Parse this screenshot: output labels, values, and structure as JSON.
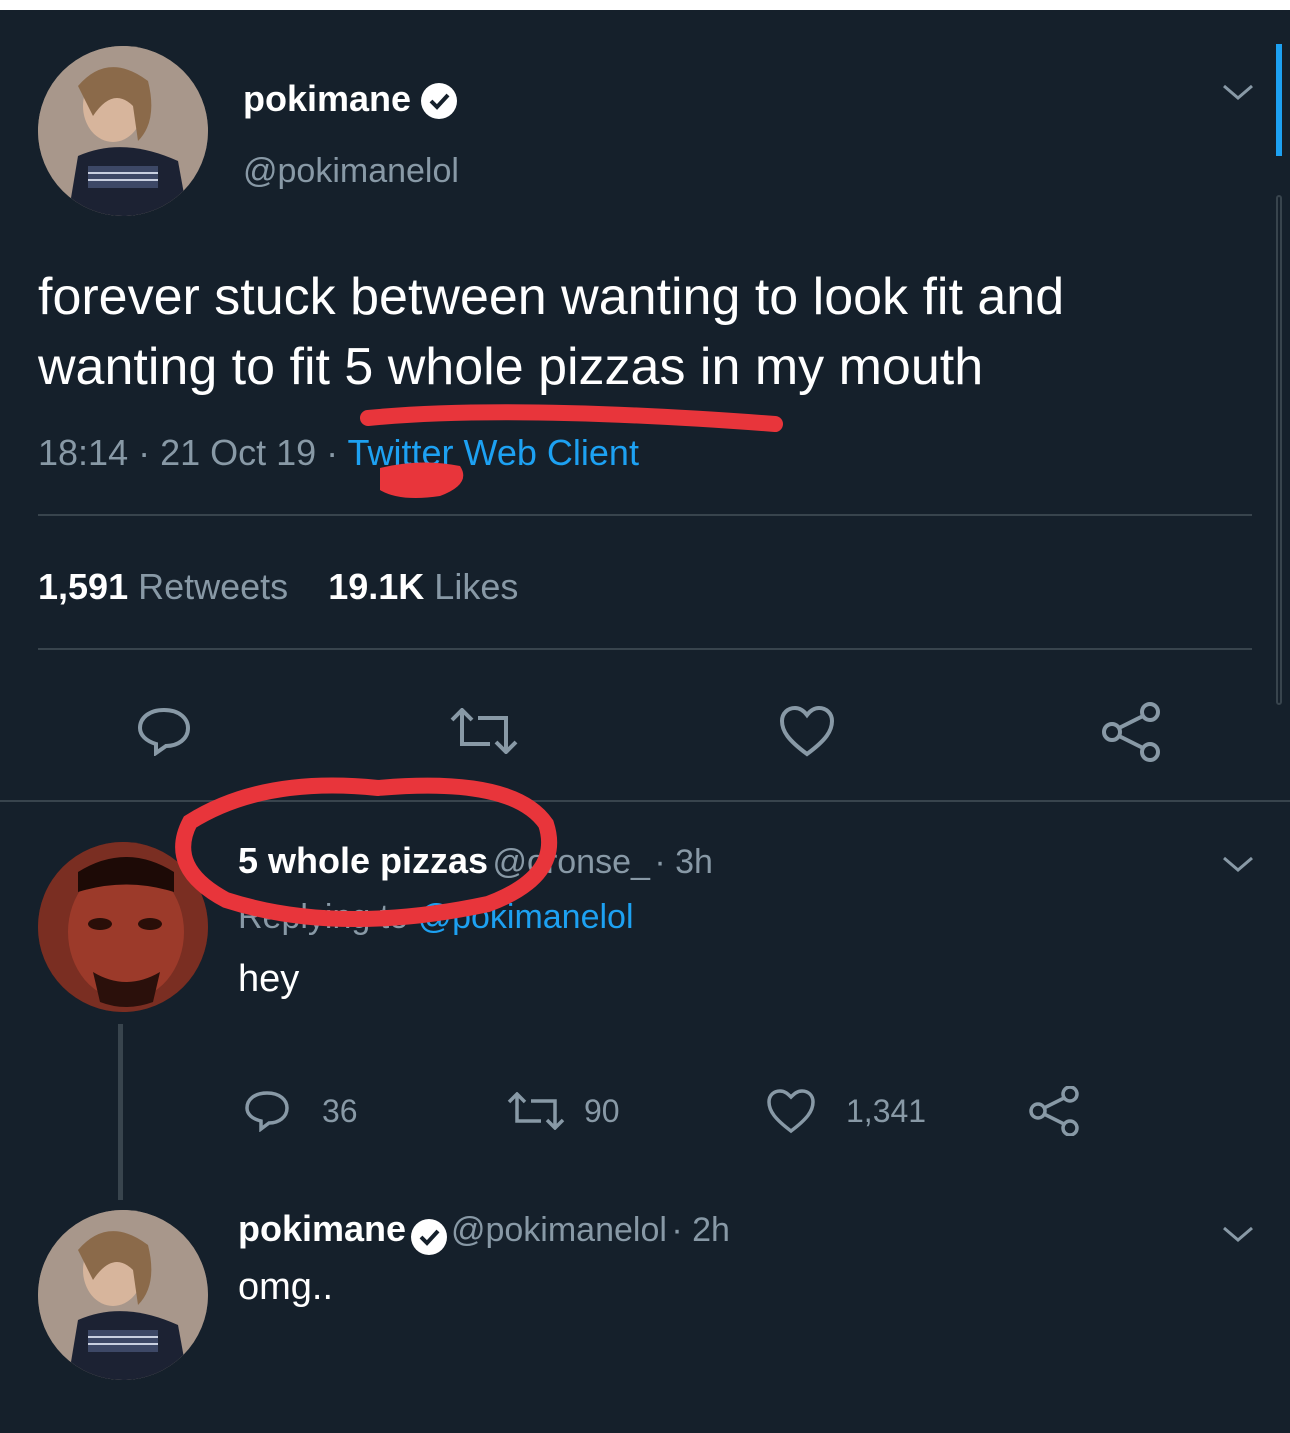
{
  "main_tweet": {
    "name": "pokimane",
    "handle": "@pokimanelol",
    "text_line1": "forever stuck between wanting to look fit and",
    "text_line2": "wanting to fit 5 whole pizzas in my mouth",
    "time": "18:14 · 21 Oct 19 ·",
    "client": "Twitter Web Client",
    "retweets_count": "1,591",
    "retweets_label": "Retweets",
    "likes_count": "19.1K",
    "likes_label": "Likes"
  },
  "reply1": {
    "name": "5 whole pizzas",
    "handle": "@oronse_",
    "time": "· 3h",
    "replying_prefix": "Replying to",
    "replying_handle": "@pokimanelol",
    "text": "hey",
    "reply_count": "36",
    "retweet_count": "90",
    "like_count": "1,341"
  },
  "reply2": {
    "name": "pokimane",
    "handle": "@pokimanelol",
    "time": "· 2h",
    "text": "omg.."
  },
  "colors": {
    "background": "#15202b",
    "secondary_text": "#8899a6",
    "link": "#1da1f2",
    "annotation": "#e8353b"
  },
  "icons": [
    "reply-icon",
    "retweet-icon",
    "like-icon",
    "share-icon",
    "verified-badge-icon",
    "chevron-down-icon"
  ]
}
